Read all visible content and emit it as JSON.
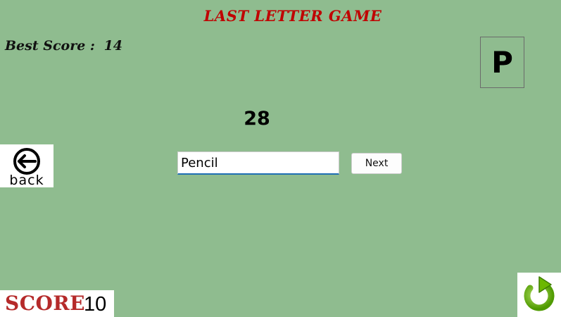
{
  "game": {
    "title": "LAST LETTER GAME",
    "best_score_label": "Best Score :",
    "best_score_value": "14",
    "current_letter": "P",
    "timer": "28"
  },
  "controls": {
    "back_label": "back",
    "word_input_value": "Pencil",
    "next_label": "Next"
  },
  "score": {
    "label": "SCORE",
    "value": "10"
  },
  "icons": {
    "back": "back-arrow-icon",
    "restart": "restart-icon"
  },
  "colors": {
    "background": "#8fbc8f",
    "title": "#c00000",
    "score_label": "#b52a2a",
    "restart_green": "#6cb800"
  }
}
